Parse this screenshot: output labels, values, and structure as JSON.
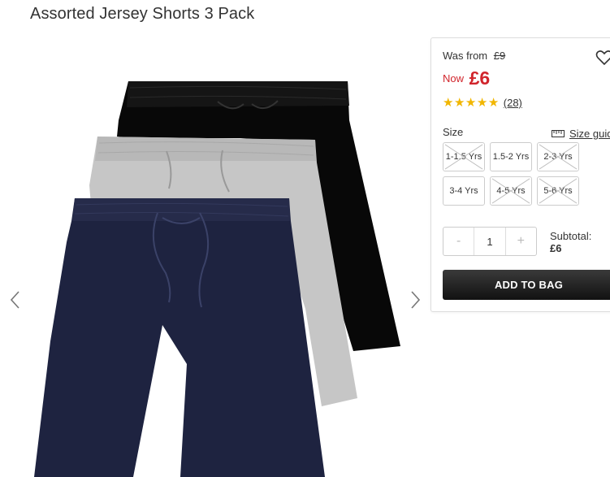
{
  "product": {
    "title": "Assorted Jersey Shorts 3 Pack"
  },
  "pricing": {
    "was_label": "Was from",
    "was_price": "£9",
    "now_label": "Now",
    "now_price": "£6",
    "accent_color": "#d1252c"
  },
  "rating": {
    "stars": 5,
    "review_count": "(28)",
    "star_color": "#f1b600"
  },
  "size": {
    "label": "Size",
    "guide_label": "Size guide",
    "options": [
      {
        "label": "1-1.5 Yrs",
        "available": false
      },
      {
        "label": "1.5-2 Yrs",
        "available": true
      },
      {
        "label": "2-3 Yrs",
        "available": false
      },
      {
        "label": "3-4 Yrs",
        "available": true
      },
      {
        "label": "4-5 Yrs",
        "available": false
      },
      {
        "label": "5-6 Yrs",
        "available": false
      }
    ]
  },
  "quantity": {
    "minus": "-",
    "value": "1",
    "plus": "+"
  },
  "subtotal": {
    "label": "Subtotal:",
    "value": "£6"
  },
  "actions": {
    "add_to_bag": "ADD TO BAG"
  },
  "gallery": {
    "prev_icon": "chevron-left-icon",
    "next_icon": "chevron-right-icon",
    "colors": [
      "#000000",
      "#c8c8c8",
      "#1e2340"
    ]
  }
}
